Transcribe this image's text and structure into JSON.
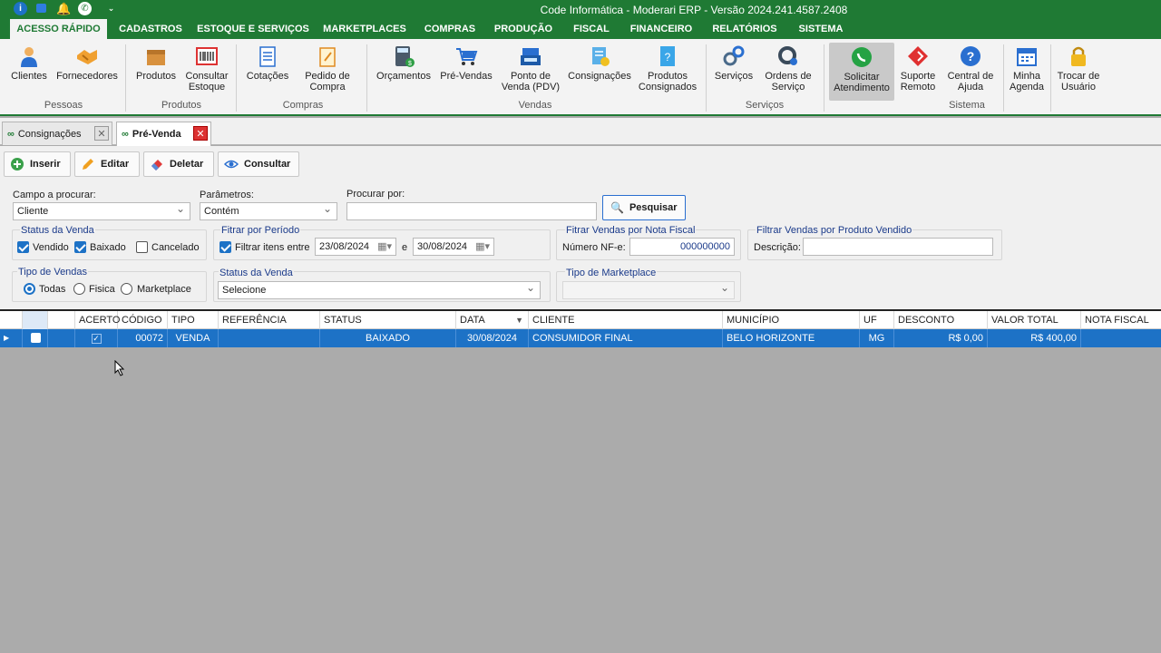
{
  "window": {
    "title": "Code Informática - Moderari ERP - Versão 2024.241.4587.2408"
  },
  "ribbon_tabs": [
    "ACESSO RÁPIDO",
    "CADASTROS",
    "ESTOQUE E SERVIÇOS",
    "MARKETPLACES",
    "COMPRAS",
    "PRODUÇÃO",
    "FISCAL",
    "FINANCEIRO",
    "RELATÓRIOS",
    "SISTEMA"
  ],
  "ribbon": {
    "buttons": {
      "clientes": "Clientes",
      "fornecedores": "Fornecedores",
      "produtos": "Produtos",
      "consultar_estoque": "Consultar Estoque",
      "cotacoes": "Cotações",
      "pedido_compra": "Pedido de Compra",
      "orcamentos": "Orçamentos",
      "pre_vendas": "Pré-Vendas",
      "pdv": "Ponto de Venda (PDV)",
      "consignacoes": "Consignações",
      "produtos_consignados": "Produtos Consignados",
      "servicos": "Serviços",
      "ordens_servico": "Ordens de Serviço",
      "solicitar_atendimento": "Solicitar Atendimento",
      "suporte_remoto": "Suporte Remoto",
      "central_ajuda": "Central de Ajuda",
      "minha_agenda": "Minha Agenda",
      "trocar_usuario": "Trocar de Usuário"
    },
    "groups": {
      "pessoas": "Pessoas",
      "produtos": "Produtos",
      "compras": "Compras",
      "vendas": "Vendas",
      "servicos": "Serviços",
      "sistema": "Sistema"
    }
  },
  "doc_tabs": {
    "consignacoes": "Consignações",
    "pre_venda": "Pré-Venda"
  },
  "toolbar": {
    "inserir": "Inserir",
    "editar": "Editar",
    "deletar": "Deletar",
    "consultar": "Consultar"
  },
  "filters": {
    "campo_label": "Campo a procurar:",
    "campo_value": "Cliente",
    "parametros_label": "Parâmetros:",
    "parametros_value": "Contém",
    "procurar_label": "Procurar por:",
    "procurar_value": "",
    "pesquisar": "Pesquisar",
    "status_title": "Status da Venda",
    "vendido": "Vendido",
    "baixado": "Baixado",
    "cancelado": "Cancelado",
    "periodo_title": "Fitrar por Período",
    "filtrar_itens": "Filtrar itens entre",
    "data_inicio": "23/08/2024",
    "e": "e",
    "data_fim": "30/08/2024",
    "nf_title": "Fitrar Vendas por Nota Fiscal",
    "nf_label": "Número NF-e:",
    "nf_value": "000000000",
    "produto_title": "Filtrar Vendas por Produto Vendido",
    "descricao_label": "Descrição:",
    "descricao_value": "",
    "tipo_title": "Tipo de Vendas",
    "todas": "Todas",
    "fisica": "Fisica",
    "marketplace": "Marketplace",
    "status2_title": "Status da Venda",
    "status2_value": "Selecione",
    "tipo_mkt_title": "Tipo de Marketplace",
    "tipo_mkt_value": ""
  },
  "grid": {
    "headers": [
      "ACERTO",
      "CÓDIGO",
      "TIPO",
      "REFERÊNCIA",
      "STATUS",
      "DATA",
      "CLIENTE",
      "MUNICÍPIO",
      "UF",
      "DESCONTO",
      "VALOR TOTAL",
      "NOTA FISCAL"
    ],
    "row": {
      "codigo": "00072",
      "tipo": "VENDA",
      "referencia": "",
      "status": "BAIXADO",
      "data": "30/08/2024",
      "cliente": "CONSUMIDOR FINAL",
      "municipio": "BELO HORIZONTE",
      "uf": "MG",
      "desconto": "R$ 0,00",
      "valor_total": "R$ 400,00",
      "nota_fiscal": ""
    }
  },
  "colors": {
    "brand_green": "#1f7a34",
    "selection_blue": "#1d72c6"
  }
}
